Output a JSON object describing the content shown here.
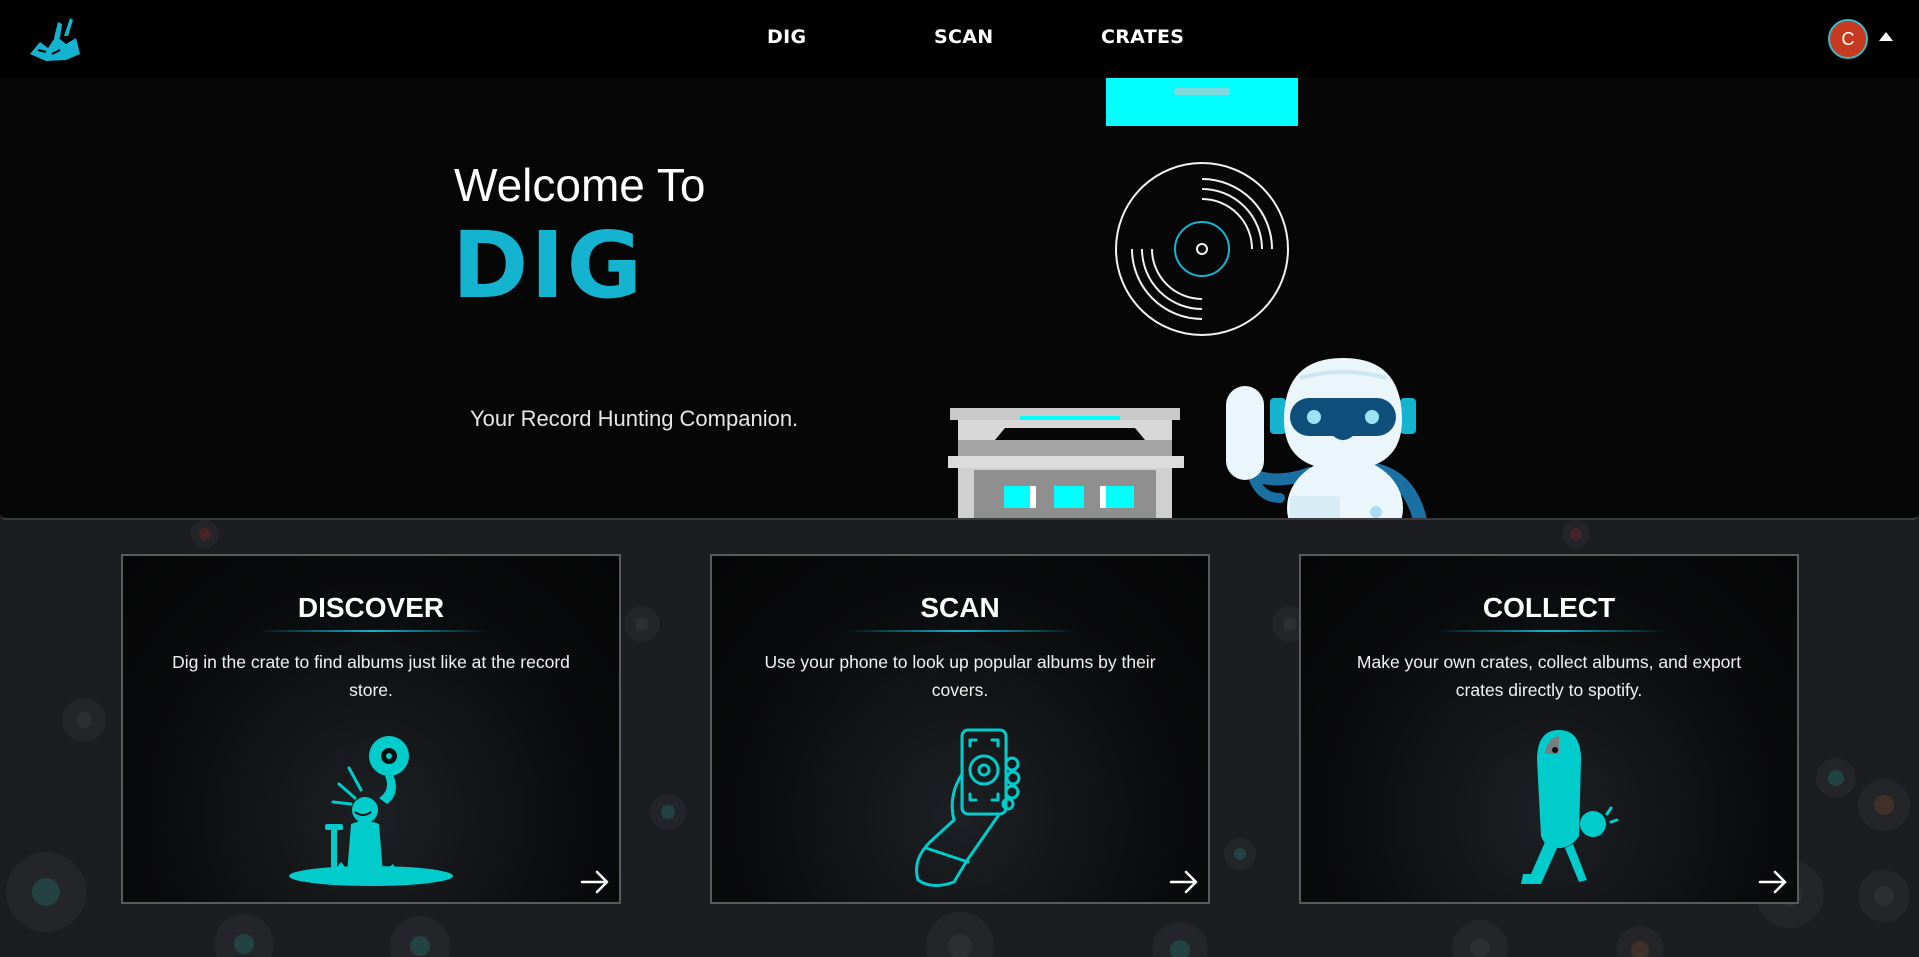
{
  "nav": {
    "links": [
      {
        "label": "DIG"
      },
      {
        "label": "SCAN"
      },
      {
        "label": "CRATES"
      }
    ],
    "avatar_initial": "C"
  },
  "hero": {
    "welcome": "Welcome To",
    "brand": "DIG",
    "tagline": "Your Record Hunting Companion."
  },
  "cards": [
    {
      "title": "DISCOVER",
      "description": "Dig in the crate to find albums just like at the record store.",
      "icon": "digger-icon"
    },
    {
      "title": "SCAN",
      "description": "Use your phone to look up popular albums by their covers.",
      "icon": "phone-scan-icon"
    },
    {
      "title": "COLLECT",
      "description": "Make your own crates, collect albums, and export crates directly to spotify.",
      "icon": "crate-carrier-icon"
    }
  ],
  "colors": {
    "accent": "#14b3cf",
    "cyan": "#00ffff",
    "avatar_bg": "#c63b1f",
    "nav_bg": "#000000",
    "page_bg": "#1c1d20"
  }
}
